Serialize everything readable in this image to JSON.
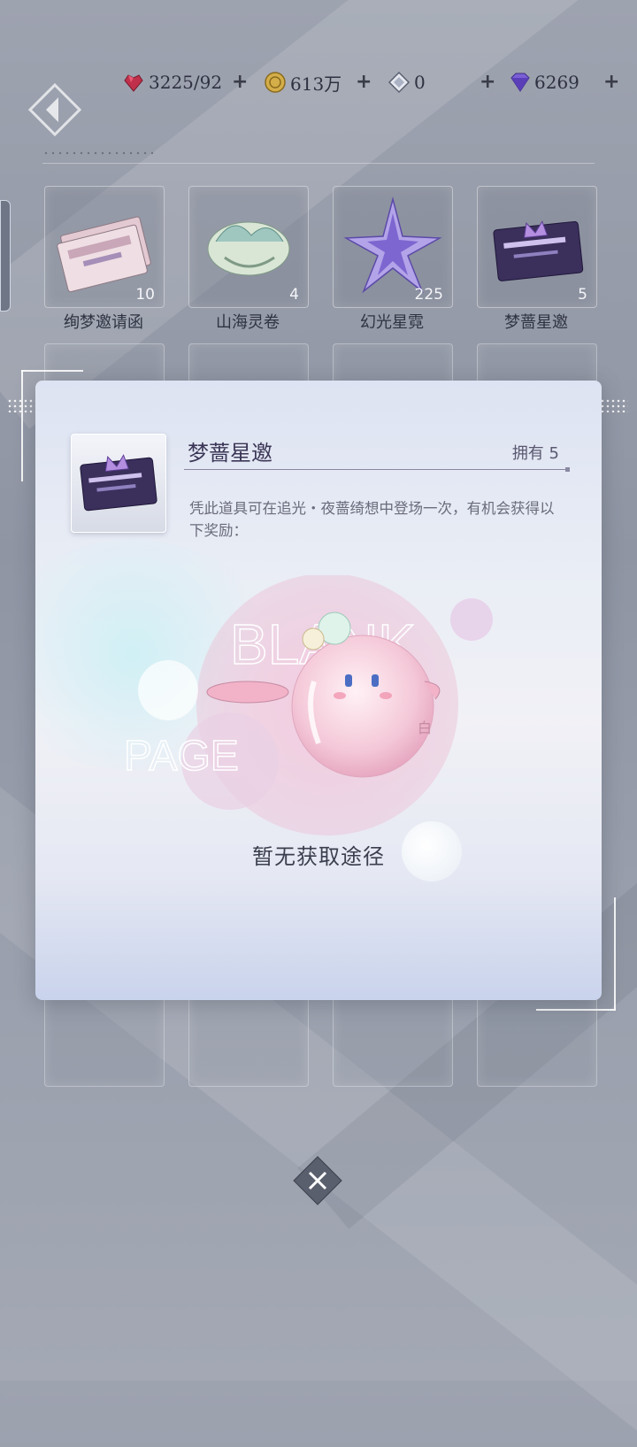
{
  "resources": [
    {
      "name": "heart-crystal",
      "value": "3225/92"
    },
    {
      "name": "gold-coin",
      "value": "613万"
    },
    {
      "name": "diamond-shard",
      "value": "0"
    },
    {
      "name": "purple-diamond",
      "value": "6269"
    }
  ],
  "plus_label": "+",
  "inventory": [
    {
      "name": "绚梦邀请函",
      "count": "10"
    },
    {
      "name": "山海灵卷",
      "count": "4"
    },
    {
      "name": "幻光星霓",
      "count": "225"
    },
    {
      "name": "梦蔷星邀",
      "count": "5"
    }
  ],
  "detail": {
    "title": "梦蔷星邀",
    "owned": "拥有 5",
    "description": "凭此道具可在追光・夜蔷绮想中登场一次，有机会获得以下奖励：",
    "placeholder_text_1": "BLANK",
    "placeholder_text_2": "PAGE",
    "mascot_badge": "白",
    "no_source": "暂无获取途径"
  },
  "close_label": "×",
  "colors": {
    "heart": "#c0304a",
    "coin": "#c9a43a",
    "purple": "#6a4fc8"
  }
}
